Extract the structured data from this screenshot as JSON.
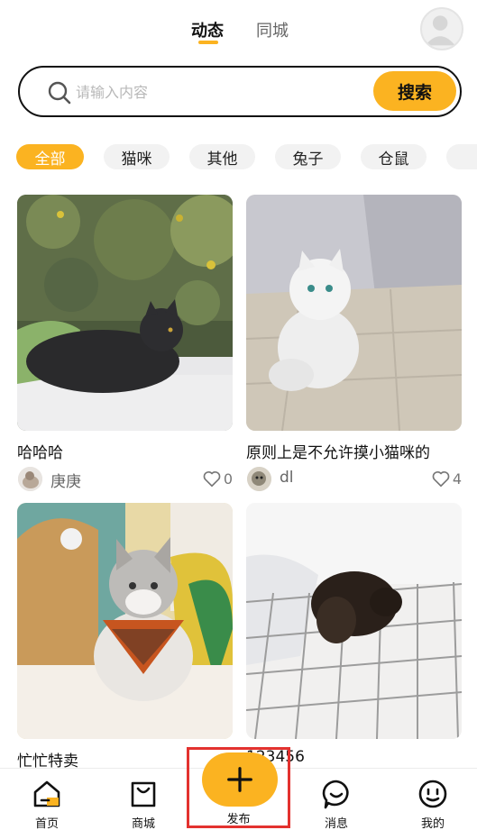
{
  "header": {
    "tabs": [
      {
        "label": "动态",
        "active": true
      },
      {
        "label": "同城",
        "active": false
      }
    ]
  },
  "search": {
    "placeholder": "请输入内容",
    "button_label": "搜索"
  },
  "categories": [
    {
      "label": "全部",
      "active": true
    },
    {
      "label": "猫咪",
      "active": false
    },
    {
      "label": "其他",
      "active": false
    },
    {
      "label": "兔子",
      "active": false
    },
    {
      "label": "仓鼠",
      "active": false
    }
  ],
  "posts": [
    {
      "title": "哈哈哈",
      "user": "庚庚",
      "likes": "0"
    },
    {
      "title": "原则上是不允许摸小猫咪的",
      "user": "dl",
      "likes": "4"
    },
    {
      "title": "忙忙特卖",
      "user": "",
      "likes": ""
    },
    {
      "title": "123456",
      "user": "",
      "likes": ""
    }
  ],
  "bottom_nav": {
    "home": "首页",
    "shop": "商城",
    "publish": "发布",
    "messages": "消息",
    "mine": "我的"
  },
  "colors": {
    "accent": "#fbb321",
    "highlight_border": "#e3322f"
  }
}
